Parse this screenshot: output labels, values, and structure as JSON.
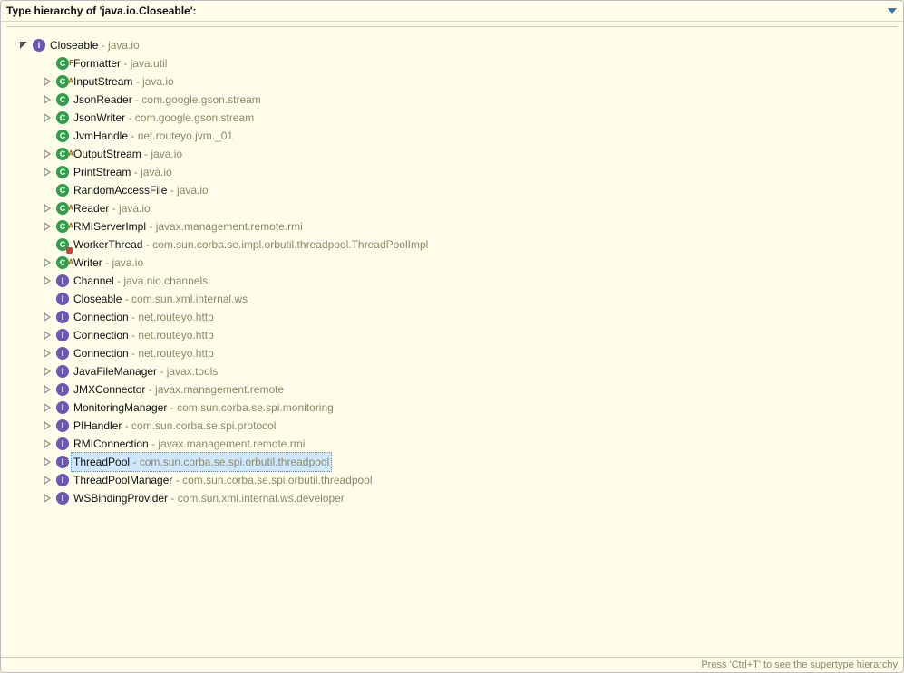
{
  "header": {
    "title": "Type hierarchy of 'java.io.Closeable':"
  },
  "footer": {
    "hint": "Press 'Ctrl+T' to see the supertype hierarchy"
  },
  "icons": {
    "interface_letter": "I",
    "class_letter": "C"
  },
  "tree": {
    "root": {
      "name": "Closeable",
      "pkg": "java.io",
      "kind": "interface",
      "expander": "expanded",
      "depth": 0
    },
    "children": [
      {
        "name": "Formatter",
        "pkg": "java.util",
        "kind": "class",
        "badge": "F",
        "expander": "none",
        "depth": 1
      },
      {
        "name": "InputStream",
        "pkg": "java.io",
        "kind": "class",
        "badge": "A",
        "expander": "collapsed",
        "depth": 1
      },
      {
        "name": "JsonReader",
        "pkg": "com.google.gson.stream",
        "kind": "class",
        "expander": "collapsed",
        "depth": 1
      },
      {
        "name": "JsonWriter",
        "pkg": "com.google.gson.stream",
        "kind": "class",
        "expander": "collapsed",
        "depth": 1
      },
      {
        "name": "JvmHandle",
        "pkg": "net.routeyo.jvm._01",
        "kind": "class",
        "expander": "none",
        "depth": 1
      },
      {
        "name": "OutputStream",
        "pkg": "java.io",
        "kind": "class",
        "badge": "A",
        "expander": "collapsed",
        "depth": 1
      },
      {
        "name": "PrintStream",
        "pkg": "java.io",
        "kind": "class",
        "expander": "collapsed",
        "depth": 1
      },
      {
        "name": "RandomAccessFile",
        "pkg": "java.io",
        "kind": "class",
        "expander": "none",
        "depth": 1
      },
      {
        "name": "Reader",
        "pkg": "java.io",
        "kind": "class",
        "badge": "A",
        "expander": "collapsed",
        "depth": 1
      },
      {
        "name": "RMIServerImpl",
        "pkg": "javax.management.remote.rmi",
        "kind": "class",
        "badge": "A",
        "expander": "collapsed",
        "depth": 1
      },
      {
        "name": "WorkerThread",
        "pkg": "com.sun.corba.se.impl.orbutil.threadpool.ThreadPoolImpl",
        "kind": "class",
        "override": true,
        "expander": "none",
        "depth": 1
      },
      {
        "name": "Writer",
        "pkg": "java.io",
        "kind": "class",
        "badge": "A",
        "expander": "collapsed",
        "depth": 1
      },
      {
        "name": "Channel",
        "pkg": "java.nio.channels",
        "kind": "interface",
        "expander": "collapsed",
        "depth": 1
      },
      {
        "name": "Closeable",
        "pkg": "com.sun.xml.internal.ws",
        "kind": "interface",
        "expander": "none",
        "depth": 1
      },
      {
        "name": "Connection",
        "pkg": "net.routeyo.http",
        "kind": "interface",
        "expander": "collapsed",
        "depth": 1
      },
      {
        "name": "Connection",
        "pkg": "net.routeyo.http",
        "kind": "interface",
        "expander": "collapsed",
        "depth": 1
      },
      {
        "name": "Connection",
        "pkg": "net.routeyo.http",
        "kind": "interface",
        "expander": "collapsed",
        "depth": 1
      },
      {
        "name": "JavaFileManager",
        "pkg": "javax.tools",
        "kind": "interface",
        "expander": "collapsed",
        "depth": 1
      },
      {
        "name": "JMXConnector",
        "pkg": "javax.management.remote",
        "kind": "interface",
        "expander": "collapsed",
        "depth": 1
      },
      {
        "name": "MonitoringManager",
        "pkg": "com.sun.corba.se.spi.monitoring",
        "kind": "interface",
        "expander": "collapsed",
        "depth": 1
      },
      {
        "name": "PIHandler",
        "pkg": "com.sun.corba.se.spi.protocol",
        "kind": "interface",
        "expander": "collapsed",
        "depth": 1
      },
      {
        "name": "RMIConnection",
        "pkg": "javax.management.remote.rmi",
        "kind": "interface",
        "expander": "collapsed",
        "depth": 1
      },
      {
        "name": "ThreadPool",
        "pkg": "com.sun.corba.se.spi.orbutil.threadpool",
        "kind": "interface",
        "expander": "collapsed",
        "depth": 1,
        "selected": true
      },
      {
        "name": "ThreadPoolManager",
        "pkg": "com.sun.corba.se.spi.orbutil.threadpool",
        "kind": "interface",
        "expander": "collapsed",
        "depth": 1
      },
      {
        "name": "WSBindingProvider",
        "pkg": "com.sun.xml.internal.ws.developer",
        "kind": "interface",
        "expander": "collapsed",
        "depth": 1
      }
    ]
  }
}
